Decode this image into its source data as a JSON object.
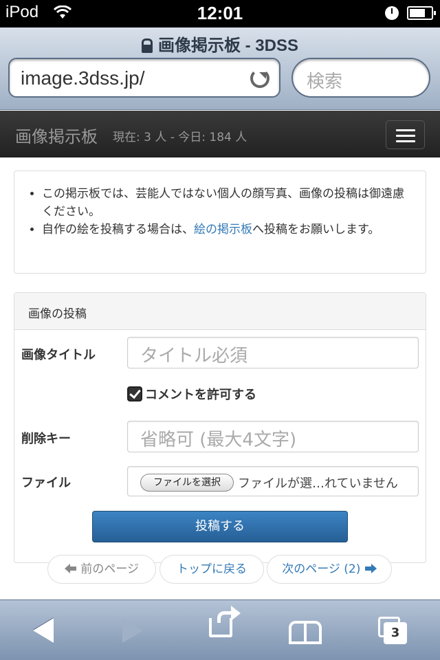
{
  "status_bar": {
    "device": "iPod",
    "time": "12:01"
  },
  "browser": {
    "page_title": "画像掲示板 - 3DSS",
    "url": "image.3dss.jp/",
    "search_placeholder": "検索"
  },
  "navbar": {
    "brand": "画像掲示板",
    "stats": "現在: 3 人 - 今日: 184 人"
  },
  "notice": {
    "item1": "この掲示板では、芸能人ではない個人の顔写真、画像の投稿は御遠慮ください。",
    "item2_prefix": "自作の絵を投稿する場合は、",
    "item2_link": "絵の掲示板",
    "item2_suffix": "へ投稿をお願いします。"
  },
  "post_form": {
    "heading": "画像の投稿",
    "title_label": "画像タイトル",
    "title_placeholder": "タイトル必須",
    "allow_comment_label": "コメントを許可する",
    "allow_comment_checked": true,
    "delete_key_label": "削除キー",
    "delete_key_placeholder": "省略可 (最大4文字)",
    "file_label": "ファイル",
    "file_button": "ファイルを選択",
    "file_status": "ファイルが選…れていません",
    "submit": "投稿する"
  },
  "pager": {
    "prev": "前のページ",
    "top": "トップに戻る",
    "next": "次のページ (2)"
  },
  "toolbar": {
    "tabs_count": "3"
  }
}
